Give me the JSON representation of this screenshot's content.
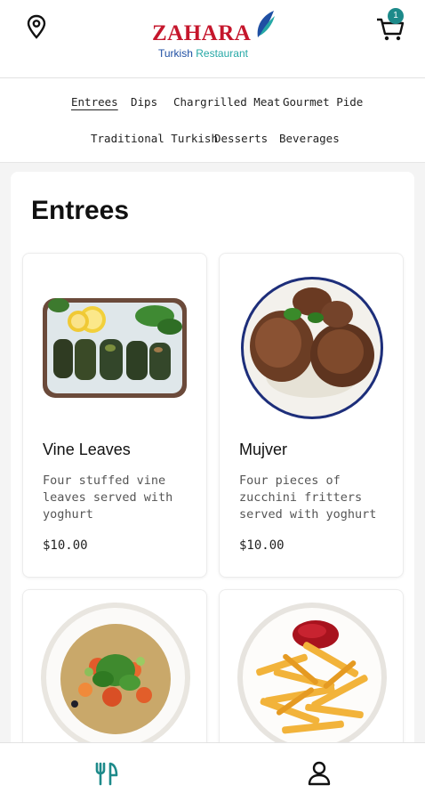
{
  "header": {
    "brand": "ZAHARA",
    "subtitle_a": "Turkish",
    "subtitle_b": "Restaurant",
    "cart_count": "1",
    "icons": {
      "location": "location-pin-icon",
      "cart": "shopping-cart-icon"
    },
    "colors": {
      "brand_red": "#c5162c",
      "brand_blue": "#1f4fa3",
      "brand_teal": "#25a8a6",
      "accent": "#1d8a8a"
    }
  },
  "categories": [
    {
      "label": "Entrees",
      "active": true
    },
    {
      "label": "Dips",
      "active": false
    },
    {
      "label": "Chargrilled Meat",
      "active": false
    },
    {
      "label": "Gourmet Pide",
      "active": false
    },
    {
      "label": "Traditional Turkish",
      "active": false
    },
    {
      "label": "Desserts",
      "active": false
    },
    {
      "label": "Beverages",
      "active": false
    }
  ],
  "section": {
    "title": "Entrees"
  },
  "items": [
    {
      "name": "Vine Leaves",
      "description": "Four stuffed vine leaves served with yoghurt",
      "price": "$10.00",
      "image": "vine-leaves-plate"
    },
    {
      "name": "Mujver",
      "description": "Four pieces of zucchini fritters served with yoghurt",
      "price": "$10.00",
      "image": "zucchini-fritters-plate"
    },
    {
      "name": "",
      "description": "",
      "price": "",
      "image": "salad-bowl"
    },
    {
      "name": "",
      "description": "",
      "price": "",
      "image": "fries-bowl"
    }
  ],
  "bottom_nav": [
    {
      "name": "menu",
      "icon": "fork-knife-icon",
      "active": true
    },
    {
      "name": "profile",
      "icon": "user-icon",
      "active": false
    }
  ]
}
